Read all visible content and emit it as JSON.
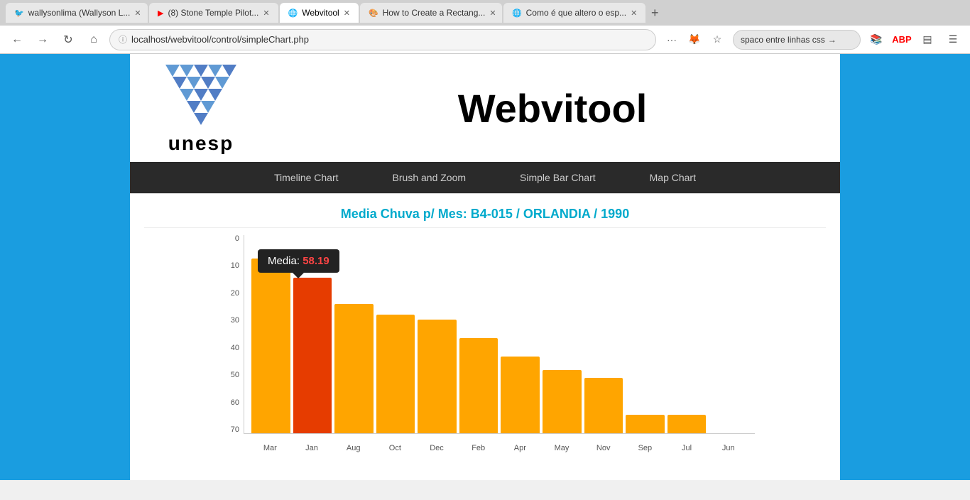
{
  "browser": {
    "tabs": [
      {
        "id": "tab1",
        "icon": "🐦",
        "label": "wallysonlima (Wallyson L...",
        "active": false,
        "closeable": true
      },
      {
        "id": "tab2",
        "icon": "▶",
        "icon_color": "red",
        "label": "(8) Stone Temple Pilot...",
        "active": false,
        "closeable": true
      },
      {
        "id": "tab3",
        "icon": "🌐",
        "label": "Webvitool",
        "active": true,
        "closeable": true
      },
      {
        "id": "tab4",
        "icon": "🎨",
        "label": "How to Create a Rectang...",
        "active": false,
        "closeable": true
      },
      {
        "id": "tab5",
        "icon": "🌐",
        "label": "Como é que altero o esp...",
        "active": false,
        "closeable": true
      }
    ],
    "url": "localhost/webvitool/control/simpleChart.php",
    "search_text": "spaco entre linhas css"
  },
  "header": {
    "title": "Webvitool",
    "logo_alt": "UNESP logo"
  },
  "nav": {
    "items": [
      {
        "id": "timeline",
        "label": "Timeline Chart"
      },
      {
        "id": "brush",
        "label": "Brush and Zoom"
      },
      {
        "id": "bar",
        "label": "Simple Bar Chart"
      },
      {
        "id": "map",
        "label": "Map Chart"
      }
    ]
  },
  "chart": {
    "title": "Media Chuva p/ Mes: B4-015 / ORLANDIA / 1990",
    "tooltip": {
      "label": "Media:",
      "value": "58.19"
    },
    "y_labels": [
      "0",
      "10",
      "20",
      "30",
      "40",
      "50",
      "60",
      "70"
    ],
    "max_value": 75,
    "bars": [
      {
        "month": "Mar",
        "value": 66,
        "color": "orange"
      },
      {
        "month": "Jan",
        "value": 59,
        "color": "red-orange"
      },
      {
        "month": "Aug",
        "value": 49,
        "color": "orange"
      },
      {
        "month": "Oct",
        "value": 45,
        "color": "orange"
      },
      {
        "month": "Dec",
        "value": 43,
        "color": "orange"
      },
      {
        "month": "Feb",
        "value": 36,
        "color": "orange"
      },
      {
        "month": "Apr",
        "value": 29,
        "color": "orange"
      },
      {
        "month": "May",
        "value": 24,
        "color": "orange"
      },
      {
        "month": "Nov",
        "value": 21,
        "color": "orange"
      },
      {
        "month": "Sep",
        "value": 7,
        "color": "orange"
      },
      {
        "month": "Jul",
        "value": 7,
        "color": "orange"
      },
      {
        "month": "Jun",
        "value": 0,
        "color": "orange"
      }
    ]
  }
}
